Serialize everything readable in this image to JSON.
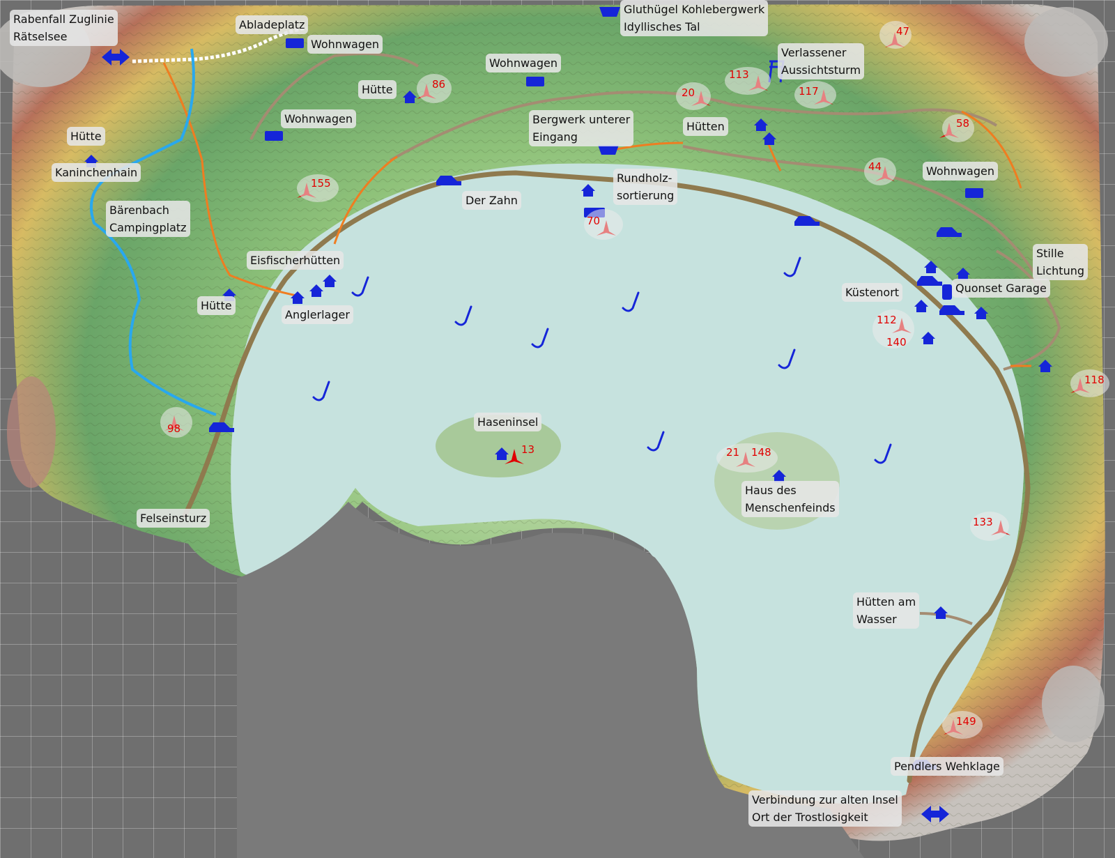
{
  "map": {
    "labels": {
      "rabenfall": [
        "Rabenfall Zuglinie",
        "Rätselsee"
      ],
      "abladeplatz": "Abladeplatz",
      "wohnwagen_1": "Wohnwagen",
      "gluthuegel": [
        "Gluthügel Kohlebergwerk",
        "Idyllisches Tal"
      ],
      "wohnwagen_2": "Wohnwagen",
      "huette_1": "Hütte",
      "verlassener": [
        "Verlassener",
        "Aussichtsturm"
      ],
      "wohnwagen_3": "Wohnwagen",
      "huette_2": "Hütte",
      "bergwerk": [
        "Bergwerk unterer",
        "Eingang"
      ],
      "huetten_1": "Hütten",
      "kaninchenhain": "Kaninchenhain",
      "wohnwagen_4": "Wohnwagen",
      "baerenbach": [
        "Bärenbach",
        "Campingplatz"
      ],
      "der_zahn": "Der Zahn",
      "rundholz": [
        "Rundholz-",
        "sortierung"
      ],
      "eisfischer": "Eisfischerhütten",
      "stille": [
        "Stille",
        "Lichtung"
      ],
      "huette_3": "Hütte",
      "kuestenort": "Küstenort",
      "quonset": "Quonset Garage",
      "anglerlager": "Anglerlager",
      "haseninsel": "Haseninsel",
      "haus": [
        "Haus des",
        "Menschenfeinds"
      ],
      "felseinsturz": "Felseinsturz",
      "huetten_wasser": [
        "Hütten am",
        "Wasser"
      ],
      "pendlers": "Pendlers Wehklage",
      "verbindung": [
        "Verbindung zur alten Insel",
        "Ort der Trostlosigkeit"
      ]
    },
    "numbers": [
      "47",
      "113",
      "86",
      "20",
      "117",
      "58",
      "155",
      "44",
      "70",
      "112",
      "140",
      "118",
      "98",
      "13",
      "21",
      "148",
      "133",
      "149"
    ],
    "colors": {
      "water": "#c6e2de",
      "marker": "#1525d8",
      "number": "#e00000",
      "road": "#8f7a4e",
      "trail": "#ef7d21",
      "stream": "#29a8ee"
    }
  }
}
